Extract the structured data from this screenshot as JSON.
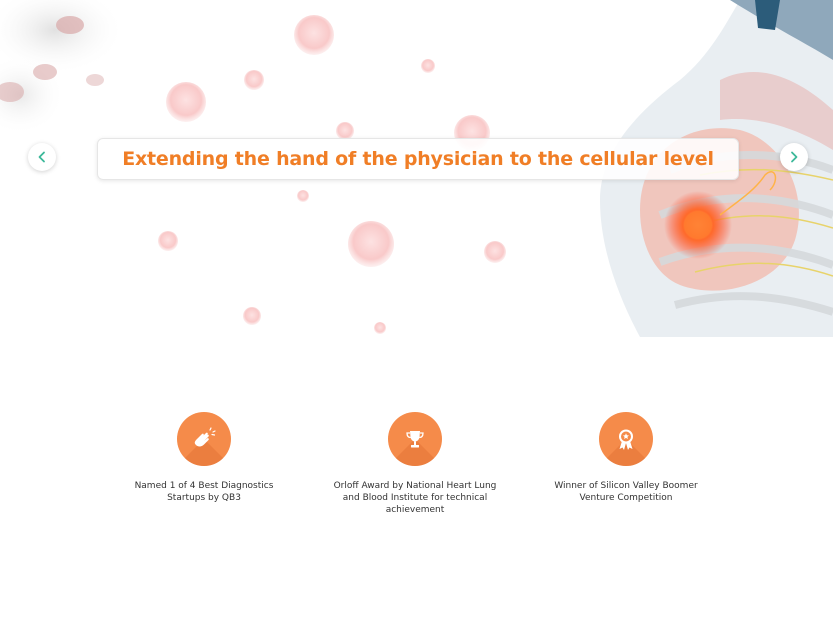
{
  "hero": {
    "caption": "Extending the hand of the physician to the cellular level",
    "prev_label": "previous slide",
    "next_label": "next slide"
  },
  "awards": [
    {
      "icon": "clapping-hands-icon",
      "text": "Named 1 of 4 Best Diagnostics Startups by QB3"
    },
    {
      "icon": "trophy-icon",
      "text": "Orloff Award by National Heart Lung and Blood Institute for technical achievement"
    },
    {
      "icon": "medal-icon",
      "text": "Winner of Silicon Valley Boomer Venture Competition"
    }
  ],
  "colors": {
    "accent": "#f07e26",
    "icon_bg": "#f58b4a",
    "arrow": "#3cb89a"
  }
}
